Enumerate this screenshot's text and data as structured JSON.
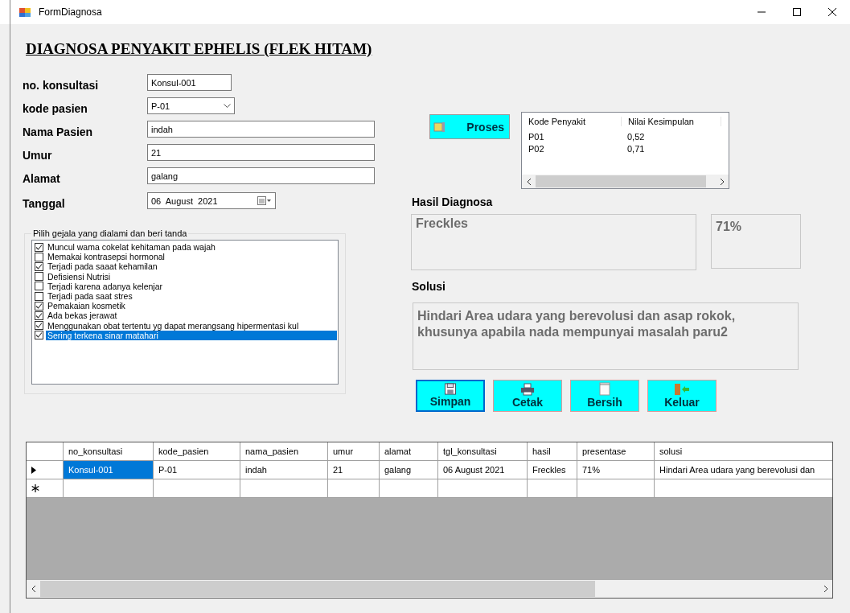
{
  "window": {
    "title": "FormDiagnosa"
  },
  "heading": "DIAGNOSA PENYAKIT EPHELIS (FLEK HITAM)",
  "fields": [
    {
      "label": "no. konsultasi",
      "value": "Konsul-001",
      "kind": "short"
    },
    {
      "label": "kode pasien",
      "value": "P-01",
      "kind": "combo"
    },
    {
      "label": "Nama Pasien",
      "value": "indah",
      "kind": "long"
    },
    {
      "label": "Umur",
      "value": "21",
      "kind": "long"
    },
    {
      "label": "Alamat",
      "value": "galang",
      "kind": "long"
    },
    {
      "label": "Tanggal",
      "value": "06  August  2021",
      "kind": "date"
    }
  ],
  "symptoms": {
    "title": "Pilih gejala yang dialami dan beri tanda",
    "items": [
      {
        "label": "Muncul wama cokelat kehitaman pada wajah",
        "checked": true,
        "selected": false
      },
      {
        "label": "Memakai kontrasepsi hormonal",
        "checked": false,
        "selected": false
      },
      {
        "label": "Terjadi pada saaat kehamilan",
        "checked": true,
        "selected": false
      },
      {
        "label": "Defisiensi Nutrisi",
        "checked": false,
        "selected": false
      },
      {
        "label": "Terjadi karena adanya kelenjar",
        "checked": false,
        "selected": false
      },
      {
        "label": "Terjadi pada saat stres",
        "checked": false,
        "selected": false
      },
      {
        "label": "Pemakaian kosmetik",
        "checked": true,
        "selected": false
      },
      {
        "label": "Ada bekas jerawat",
        "checked": true,
        "selected": false
      },
      {
        "label": "Menggunakan obat tertentu yg dapat merangsang hipermentasi kul",
        "checked": true,
        "selected": false
      },
      {
        "label": "Sering terkena sinar matahari",
        "checked": true,
        "selected": true
      }
    ]
  },
  "process_button": "Proses",
  "results": {
    "columns": [
      "Kode Penyakit",
      "Nilai Kesimpulan"
    ],
    "rows": [
      [
        "P01",
        "0,52"
      ],
      [
        "P02",
        "0,71"
      ]
    ]
  },
  "diagnosis": {
    "label": "Hasil Diagnosa",
    "value": "Freckles",
    "percent": "71%"
  },
  "solution": {
    "label": "Solusi",
    "value": "Hindari Area udara yang berevolusi dan asap rokok, khusunya apabila nada mempunyai masalah paru2"
  },
  "buttons": [
    {
      "label": "Simpan",
      "kind": "save",
      "focused": true
    },
    {
      "label": "Cetak",
      "kind": "print",
      "focused": false
    },
    {
      "label": "Bersih",
      "kind": "clear",
      "focused": false
    },
    {
      "label": "Keluar",
      "kind": "exit",
      "focused": false
    }
  ],
  "grid": {
    "columns": [
      "no_konsultasi",
      "kode_pasien",
      "nama_pasien",
      "umur",
      "alamat",
      "tgl_konsultasi",
      "hasil",
      "presentase",
      "solusi"
    ],
    "rows": [
      {
        "current": true,
        "cells": [
          {
            "text": "Konsul-001",
            "selected": true
          },
          {
            "text": "P-01",
            "selected": false
          },
          {
            "text": "indah",
            "selected": false
          },
          {
            "text": "21",
            "selected": false
          },
          {
            "text": "galang",
            "selected": false
          },
          {
            "text": "06 August 2021",
            "selected": false
          },
          {
            "text": "Freckles",
            "selected": false
          },
          {
            "text": "71%",
            "selected": false
          },
          {
            "text": "Hindari Area udara yang berevolusi dan",
            "selected": false
          }
        ]
      }
    ],
    "new_row": true
  }
}
